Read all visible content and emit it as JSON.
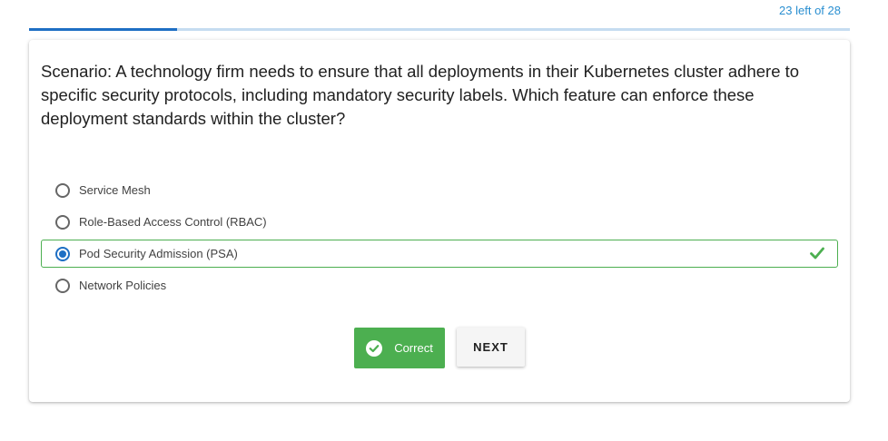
{
  "header": {
    "counter": "23 left of 28",
    "progress_fraction": 0.18
  },
  "question": {
    "text": "Scenario: A technology firm needs to ensure that all deployments in their Kubernetes cluster adhere to specific security protocols, including mandatory security labels. Which feature can enforce these deployment standards within the cluster?"
  },
  "options": [
    {
      "label": "Service Mesh",
      "selected": false,
      "correct": false
    },
    {
      "label": "Role-Based Access Control (RBAC)",
      "selected": false,
      "correct": false
    },
    {
      "label": "Pod Security Admission (PSA)",
      "selected": true,
      "correct": true
    },
    {
      "label": "Network Policies",
      "selected": false,
      "correct": false
    }
  ],
  "actions": {
    "result_label": "Correct",
    "next_label": "NEXT"
  },
  "colors": {
    "accent": "#1e6fc4",
    "success": "#4caf50",
    "counter": "#2a8fd1"
  }
}
